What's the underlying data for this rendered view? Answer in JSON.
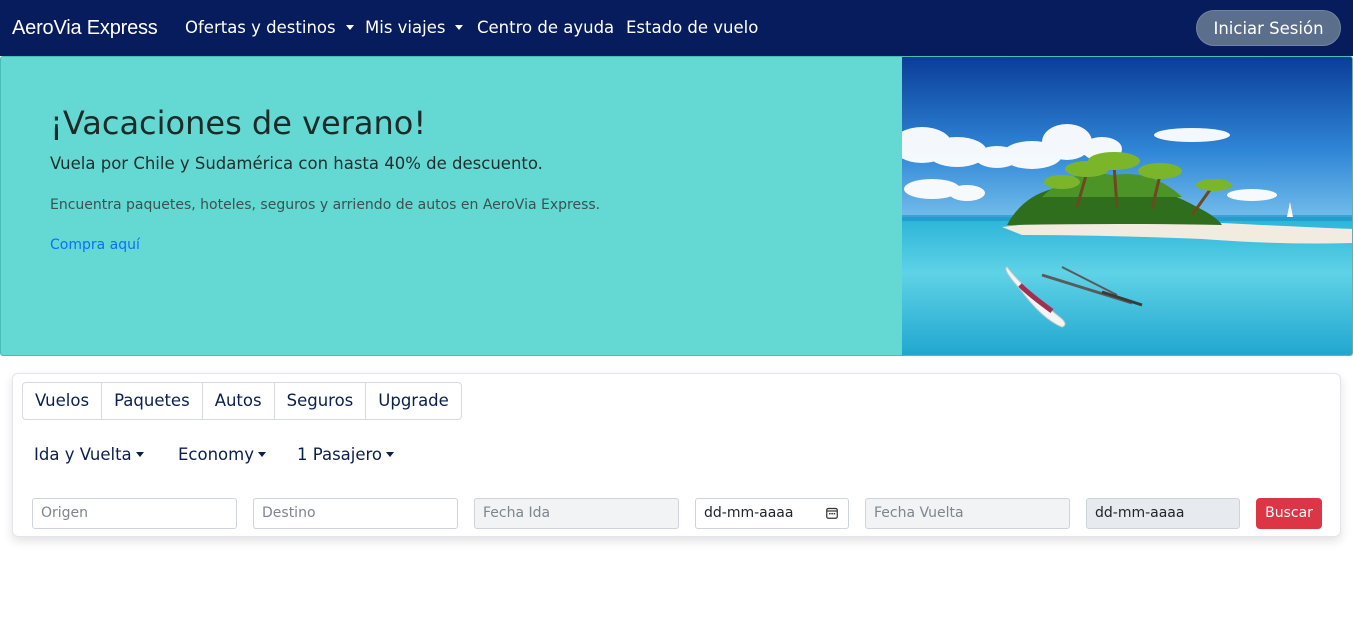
{
  "navbar": {
    "brand": "AeroVia Express",
    "items": [
      {
        "label": "Ofertas y destinos",
        "dropdown": true
      },
      {
        "label": "Mis viajes",
        "dropdown": true
      },
      {
        "label": "Centro de ayuda",
        "dropdown": false
      },
      {
        "label": "Estado de vuelo",
        "dropdown": false
      }
    ],
    "login_label": "Iniciar Sesión"
  },
  "hero": {
    "title": "¡Vacaciones de verano!",
    "subtitle": "Vuela por Chile y Sudamérica con hasta 40% de descuento.",
    "text": "Encuentra paquetes, hoteles, seguros y arriendo de autos en AeroVia Express.",
    "link_label": "Compra aquí",
    "image_icon": "tropical-island-photo"
  },
  "search": {
    "tabs": [
      "Vuelos",
      "Paquetes",
      "Autos",
      "Seguros",
      "Upgrade"
    ],
    "trip_type": "Ida y Vuelta",
    "cabin_class": "Economy",
    "passengers": "1 Pasajero",
    "origin_placeholder": "Origen",
    "destination_placeholder": "Destino",
    "depart_label": "Fecha Ida",
    "depart_date_placeholder": "dd-mm-aaaa",
    "return_label": "Fecha Vuelta",
    "return_date_placeholder": "dd-mm-aaaa",
    "search_label": "Buscar"
  },
  "colors": {
    "navbar": "#061c5c",
    "hero_bg": "#64d9d3",
    "link": "#0d6efd",
    "search_button": "#dc3545"
  }
}
